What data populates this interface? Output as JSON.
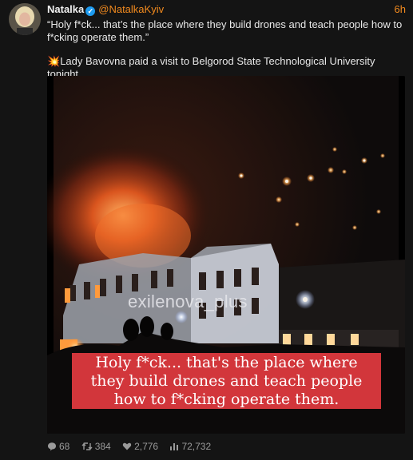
{
  "author": {
    "name": "Natalka",
    "verified": "✓",
    "handle": "@NatalkaKyiv",
    "avatar": "avatar-photo"
  },
  "time": "6h",
  "tweet": {
    "line1": "“Holy f*ck... that’s the place where they build drones and teach people how to f*cking operate them.”",
    "emoji": "💥",
    "line2": "Lady Bavovna paid a visit to Belgorod State Technological University tonight."
  },
  "media": {
    "watermark": "exilenova_plus",
    "caption_lines": [
      "Holy f*ck... that's the place where",
      "they build drones and teach people",
      "how to f*cking operate them."
    ],
    "caption_bg": "#e23a40"
  },
  "stats": {
    "replies": "68",
    "retweets": "384",
    "likes": "2,776",
    "views": "72,732"
  },
  "colors": {
    "accent": "#f28a1e",
    "verified": "#1d9bf0",
    "background": "#141414"
  }
}
